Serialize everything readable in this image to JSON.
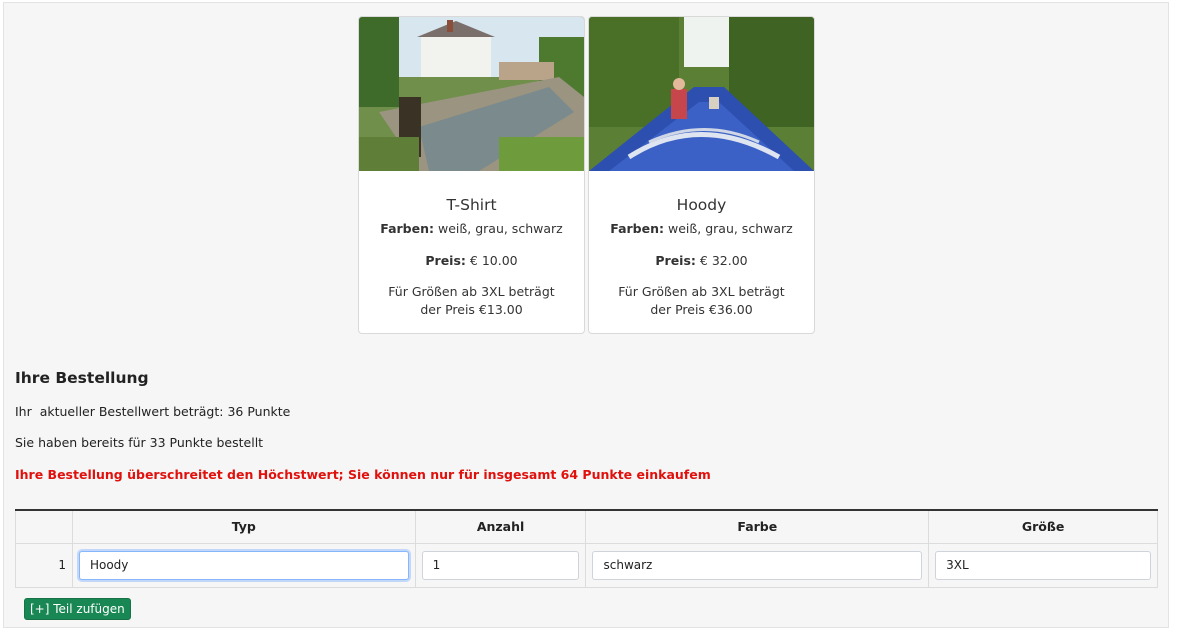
{
  "products": [
    {
      "name": "T-Shirt",
      "colors_label": "Farben:",
      "colors": "weiß, grau, schwarz",
      "price_label": "Preis:",
      "price": "€ 10.00",
      "note": "Für Größen ab 3XL beträgt der Preis €13.00"
    },
    {
      "name": "Hoody",
      "colors_label": "Farben:",
      "colors": "weiß, grau, schwarz",
      "price_label": "Preis:",
      "price": "€ 32.00",
      "note": "Für Größen ab 3XL beträgt der Preis €36.00"
    }
  ],
  "order": {
    "title": "Ihre Bestellung",
    "current_value_text": "Ihr  aktueller Bestellwert beträgt: 36 Punkte",
    "already_ordered_text": "Sie haben bereits für 33 Punkte bestellt",
    "warning_text": "Ihre Bestellung überschreitet den Höchstwert; Sie können nur für insgesamt 64 Punkte einkaufem",
    "warning_color": "#e0110d",
    "columns": [
      "",
      "Typ",
      "Anzahl",
      "Farbe",
      "Größe"
    ],
    "rows": [
      {
        "index": "1",
        "type": "Hoody",
        "quantity": "1",
        "color": "schwarz",
        "size": "3XL"
      }
    ],
    "add_button_label": "[+] Teil zufügen",
    "add_button_color": "#198754"
  }
}
